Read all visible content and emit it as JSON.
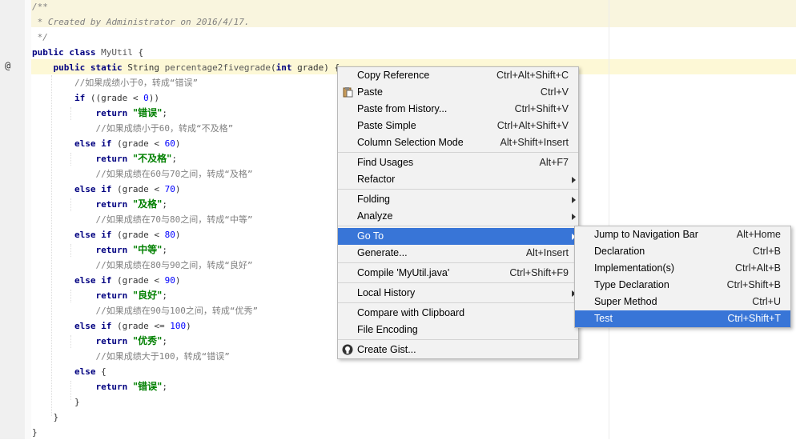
{
  "editor": {
    "override_marker": "@",
    "lines": [
      [
        {
          "t": "/**",
          "c": "cm"
        }
      ],
      [
        {
          "t": " * Created by Administrator on 2016/4/17.",
          "c": "cm"
        }
      ],
      [
        {
          "t": " */",
          "c": "cm"
        }
      ],
      [
        {
          "t": "public class ",
          "c": "kw"
        },
        {
          "t": "MyUtil",
          "c": "method"
        },
        {
          "t": " {",
          "c": "ident"
        }
      ],
      [
        {
          "t": "    public static ",
          "c": "kw"
        },
        {
          "t": "String ",
          "c": "ident"
        },
        {
          "t": "percentage2fivegrade",
          "c": "method"
        },
        {
          "t": "(",
          "c": "ident"
        },
        {
          "t": "int ",
          "c": "kw"
        },
        {
          "t": "grade) {",
          "c": "ident"
        }
      ],
      [
        {
          "t": "        //如果成绩小于0，转成“错误”",
          "c": "lc"
        }
      ],
      [
        {
          "t": "        if ",
          "c": "kw"
        },
        {
          "t": "((grade < ",
          "c": "ident"
        },
        {
          "t": "0",
          "c": "num"
        },
        {
          "t": "))",
          "c": "ident"
        }
      ],
      [
        {
          "t": "            return ",
          "c": "kw"
        },
        {
          "t": "\"错误\"",
          "c": "str"
        },
        {
          "t": ";",
          "c": "ident"
        }
      ],
      [
        {
          "t": "            //如果成绩小于60，转成“不及格”",
          "c": "lc"
        }
      ],
      [
        {
          "t": "        else if ",
          "c": "kw"
        },
        {
          "t": "(grade < ",
          "c": "ident"
        },
        {
          "t": "60",
          "c": "num"
        },
        {
          "t": ")",
          "c": "ident"
        }
      ],
      [
        {
          "t": "            return ",
          "c": "kw"
        },
        {
          "t": "\"不及格\"",
          "c": "str"
        },
        {
          "t": ";",
          "c": "ident"
        }
      ],
      [
        {
          "t": "            //如果成绩在60与70之间，转成“及格”",
          "c": "lc"
        }
      ],
      [
        {
          "t": "        else if ",
          "c": "kw"
        },
        {
          "t": "(grade < ",
          "c": "ident"
        },
        {
          "t": "70",
          "c": "num"
        },
        {
          "t": ")",
          "c": "ident"
        }
      ],
      [
        {
          "t": "            return ",
          "c": "kw"
        },
        {
          "t": "\"及格\"",
          "c": "str"
        },
        {
          "t": ";",
          "c": "ident"
        }
      ],
      [
        {
          "t": "            //如果成绩在70与80之间，转成“中等”",
          "c": "lc"
        }
      ],
      [
        {
          "t": "        else if ",
          "c": "kw"
        },
        {
          "t": "(grade < ",
          "c": "ident"
        },
        {
          "t": "80",
          "c": "num"
        },
        {
          "t": ")",
          "c": "ident"
        }
      ],
      [
        {
          "t": "            return ",
          "c": "kw"
        },
        {
          "t": "\"中等\"",
          "c": "str"
        },
        {
          "t": ";",
          "c": "ident"
        }
      ],
      [
        {
          "t": "            //如果成绩在80与90之间，转成“良好”",
          "c": "lc"
        }
      ],
      [
        {
          "t": "        else if ",
          "c": "kw"
        },
        {
          "t": "(grade < ",
          "c": "ident"
        },
        {
          "t": "90",
          "c": "num"
        },
        {
          "t": ")",
          "c": "ident"
        }
      ],
      [
        {
          "t": "            return ",
          "c": "kw"
        },
        {
          "t": "\"良好\"",
          "c": "str"
        },
        {
          "t": ";",
          "c": "ident"
        }
      ],
      [
        {
          "t": "            //如果成绩在90与100之间，转成“优秀”",
          "c": "lc"
        }
      ],
      [
        {
          "t": "        else if ",
          "c": "kw"
        },
        {
          "t": "(grade <= ",
          "c": "ident"
        },
        {
          "t": "100",
          "c": "num"
        },
        {
          "t": ")",
          "c": "ident"
        }
      ],
      [
        {
          "t": "            return ",
          "c": "kw"
        },
        {
          "t": "\"优秀\"",
          "c": "str"
        },
        {
          "t": ";",
          "c": "ident"
        }
      ],
      [
        {
          "t": "            //如果成绩大于100，转成“错误”",
          "c": "lc"
        }
      ],
      [
        {
          "t": "        else ",
          "c": "kw"
        },
        {
          "t": "{",
          "c": "ident"
        }
      ],
      [
        {
          "t": "            return ",
          "c": "kw"
        },
        {
          "t": "\"错误\"",
          "c": "str"
        },
        {
          "t": ";",
          "c": "ident"
        }
      ],
      [
        {
          "t": "        }",
          "c": "ident"
        }
      ],
      [
        {
          "t": "    }",
          "c": "ident"
        }
      ],
      [
        {
          "t": "}",
          "c": "ident"
        }
      ]
    ]
  },
  "context_menu": {
    "groups": [
      [
        {
          "label": "Copy Reference",
          "shortcut": "Ctrl+Alt+Shift+C"
        },
        {
          "label": "Paste",
          "shortcut": "Ctrl+V",
          "icon": "paste-icon"
        },
        {
          "label": "Paste from History...",
          "shortcut": "Ctrl+Shift+V"
        },
        {
          "label": "Paste Simple",
          "shortcut": "Ctrl+Alt+Shift+V"
        },
        {
          "label": "Column Selection Mode",
          "shortcut": "Alt+Shift+Insert"
        }
      ],
      [
        {
          "label": "Find Usages",
          "shortcut": "Alt+F7"
        },
        {
          "label": "Refactor",
          "shortcut": "",
          "submenu": true
        }
      ],
      [
        {
          "label": "Folding",
          "shortcut": "",
          "submenu": true
        },
        {
          "label": "Analyze",
          "shortcut": "",
          "submenu": true
        }
      ],
      [
        {
          "label": "Go To",
          "shortcut": "",
          "submenu": true,
          "selected": true
        },
        {
          "label": "Generate...",
          "shortcut": "Alt+Insert"
        }
      ],
      [
        {
          "label": "Compile 'MyUtil.java'",
          "shortcut": "Ctrl+Shift+F9"
        }
      ],
      [
        {
          "label": "Local History",
          "shortcut": "",
          "submenu": true
        }
      ],
      [
        {
          "label": "Compare with Clipboard",
          "shortcut": ""
        },
        {
          "label": "File Encoding",
          "shortcut": ""
        }
      ],
      [
        {
          "label": "Create Gist...",
          "shortcut": "",
          "icon": "github-icon"
        }
      ]
    ]
  },
  "goto_submenu": {
    "items": [
      {
        "label": "Jump to Navigation Bar",
        "shortcut": "Alt+Home"
      },
      {
        "label": "Declaration",
        "shortcut": "Ctrl+B"
      },
      {
        "label": "Implementation(s)",
        "shortcut": "Ctrl+Alt+B"
      },
      {
        "label": "Type Declaration",
        "shortcut": "Ctrl+Shift+B"
      },
      {
        "label": "Super Method",
        "shortcut": "Ctrl+U"
      },
      {
        "label": "Test",
        "shortcut": "Ctrl+Shift+T",
        "selected": true
      }
    ]
  },
  "colors": {
    "selection": "#3875d7",
    "current_line": "#fdf8d6"
  }
}
